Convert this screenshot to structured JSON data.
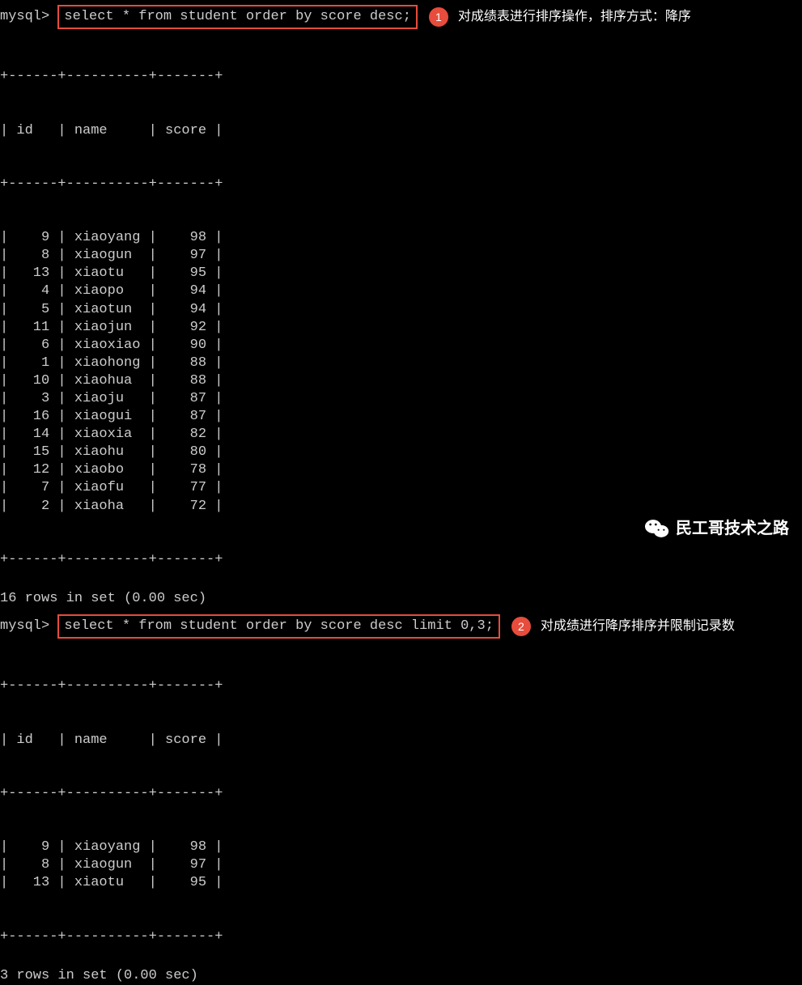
{
  "prompt": "mysql>",
  "query1": {
    "sql": "select * from student order by score desc;",
    "badge": "1",
    "annotation": "对成绩表进行排序操作，排序方式：降序"
  },
  "query2": {
    "sql": "select * from student order by score desc limit 0,3;",
    "badge": "2",
    "annotation": "对成绩进行降序排序并限制记录数"
  },
  "table1": {
    "headers": [
      "id",
      "name",
      "score"
    ],
    "rows": [
      {
        "id": "9",
        "name": "xiaoyang",
        "score": "98"
      },
      {
        "id": "8",
        "name": "xiaogun",
        "score": "97"
      },
      {
        "id": "13",
        "name": "xiaotu",
        "score": "95"
      },
      {
        "id": "4",
        "name": "xiaopo",
        "score": "94"
      },
      {
        "id": "5",
        "name": "xiaotun",
        "score": "94"
      },
      {
        "id": "11",
        "name": "xiaojun",
        "score": "92"
      },
      {
        "id": "6",
        "name": "xiaoxiao",
        "score": "90"
      },
      {
        "id": "1",
        "name": "xiaohong",
        "score": "88"
      },
      {
        "id": "10",
        "name": "xiaohua",
        "score": "88"
      },
      {
        "id": "3",
        "name": "xiaoju",
        "score": "87"
      },
      {
        "id": "16",
        "name": "xiaogui",
        "score": "87"
      },
      {
        "id": "14",
        "name": "xiaoxia",
        "score": "82"
      },
      {
        "id": "15",
        "name": "xiaohu",
        "score": "80"
      },
      {
        "id": "12",
        "name": "xiaobo",
        "score": "78"
      },
      {
        "id": "7",
        "name": "xiaofu",
        "score": "77"
      },
      {
        "id": "2",
        "name": "xiaoha",
        "score": "72"
      }
    ],
    "status": "16 rows in set (0.00 sec)"
  },
  "table2": {
    "headers": [
      "id",
      "name",
      "score"
    ],
    "rows": [
      {
        "id": "9",
        "name": "xiaoyang",
        "score": "98"
      },
      {
        "id": "8",
        "name": "xiaogun",
        "score": "97"
      },
      {
        "id": "13",
        "name": "xiaotu",
        "score": "95"
      }
    ],
    "status": "3 rows in set (0.00 sec)"
  },
  "divider": "+------+----------+-------+",
  "watermark": "民工哥技术之路"
}
